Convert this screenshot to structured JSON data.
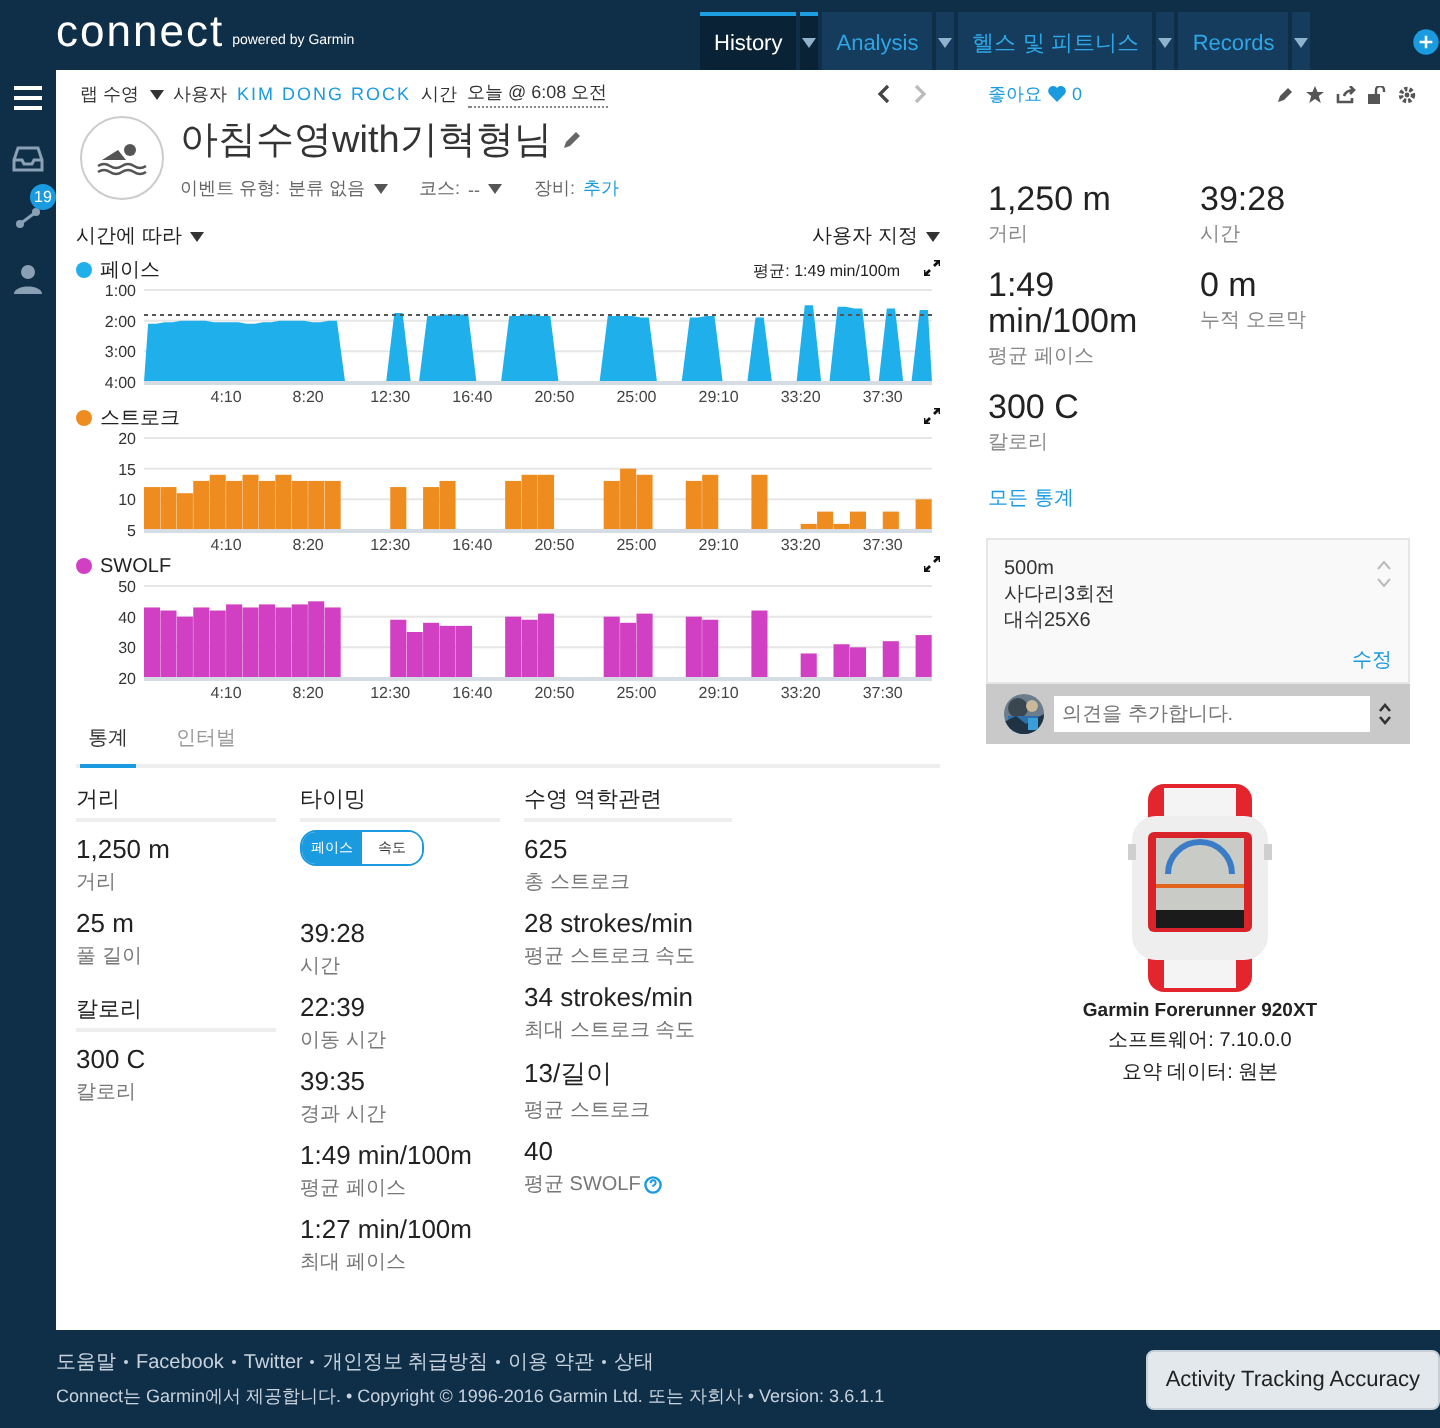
{
  "header": {
    "logo": "connect",
    "tagline": "powered by Garmin",
    "tabs": [
      {
        "label": "History",
        "selected": true
      },
      {
        "label": "Analysis",
        "selected": false
      },
      {
        "label": "헬스 및 피트니스",
        "selected": false
      },
      {
        "label": "Records",
        "selected": false
      }
    ]
  },
  "sidebar": {
    "items": [
      {
        "kind": "menu"
      },
      {
        "kind": "inbox"
      },
      {
        "kind": "connections",
        "badge": "19"
      },
      {
        "kind": "profile"
      }
    ]
  },
  "activity": {
    "type": "랩 수영",
    "by_label": "사용자",
    "user": "KIM DONG ROCK",
    "time_label": "시간",
    "time": "오늘 @ 6:08 오전",
    "likes_label": "좋아요",
    "likes": "0",
    "name": "아침수영with기혁형님",
    "event_type_label": "이벤트 유형:",
    "event_type": "분류 없음",
    "course_label": "코스:",
    "course": "--",
    "gear_label": "장비:",
    "gear": "추가"
  },
  "chart_controls": {
    "x_axis": "시간에 따라",
    "view": "사용자 지정"
  },
  "charts": [
    {
      "chart_data": {
        "type": "area",
        "title": "페이스",
        "x": [
          0,
          12.5,
          37.5,
          62.5,
          87.5,
          112.5,
          137.5,
          162.5,
          187.5,
          212.5,
          237.5,
          262.5,
          287.5,
          312.5,
          337.5,
          362.5,
          387.5,
          412.5,
          437.5,
          462.5,
          487.5,
          512.5,
          537.5,
          562.5,
          587.5,
          612.5,
          637.5,
          662.5,
          687.5,
          712.5,
          737.5,
          762.5,
          787.5,
          812.5,
          837.5,
          862.5,
          887.5,
          912.5,
          937.5,
          962.5,
          987.5,
          1012.5,
          1037.5,
          1062.5,
          1087.5,
          1112.5,
          1137.5,
          1162.5,
          1187.5,
          1212.5,
          1237.5,
          1262.5,
          1287.5,
          1312.5,
          1337.5,
          1362.5,
          1387.5,
          1412.5,
          1437.5,
          1462.5,
          1487.5,
          1512.5,
          1537.5,
          1562.5,
          1587.5,
          1612.5,
          1637.5,
          1662.5,
          1687.5,
          1712.5,
          1737.5,
          1762.5,
          1787.5,
          1812.5,
          1837.5,
          1862.5,
          1887.5,
          1912.5,
          1937.5,
          1962.5,
          1987.5,
          2012.5,
          2037.5,
          2062.5,
          2087.5,
          2112.5,
          2137.5,
          2162.5,
          2187.5,
          2212.5,
          2237.5,
          2262.5,
          2287.5,
          2312.5,
          2337.5,
          2362.5,
          2387.5,
          2400
        ],
        "xlim": [
          0,
          2400
        ],
        "ylim": [
          4,
          1
        ],
        "series": [
          {
            "color": "#1fb0ec",
            "values": [
              4,
              2.1,
              2.1,
              2.05,
              2.05,
              2.0,
              2.0,
              2.0,
              2.0,
              2.05,
              2.05,
              2.05,
              2.05,
              2.1,
              2.1,
              2.05,
              2.05,
              2.0,
              2.0,
              2.0,
              2.0,
              2.05,
              2.05,
              2.0,
              2.0,
              4,
              4,
              4,
              4,
              4,
              4,
              1.75,
              1.75,
              4,
              4,
              1.85,
              1.85,
              1.8,
              1.8,
              1.8,
              1.8,
              4,
              4,
              4,
              4,
              1.85,
              1.85,
              1.8,
              1.8,
              1.85,
              1.85,
              4,
              4,
              4,
              4,
              4,
              4,
              1.85,
              1.85,
              1.85,
              1.85,
              1.9,
              1.9,
              4,
              4,
              4,
              4,
              1.9,
              1.9,
              1.85,
              1.85,
              4,
              4,
              4,
              4,
              1.9,
              1.9,
              4,
              4,
              4,
              4,
              1.5,
              1.5,
              4,
              4,
              1.55,
              1.55,
              1.6,
              1.6,
              4,
              4,
              1.6,
              1.6,
              4,
              4,
              1.65,
              1.65,
              4
            ]
          }
        ],
        "xticks": [
          {
            "value": 250,
            "label": "4:10"
          },
          {
            "value": 500,
            "label": "8:20"
          },
          {
            "value": 750,
            "label": "12:30"
          },
          {
            "value": 1000,
            "label": "16:40"
          },
          {
            "value": 1250,
            "label": "20:50"
          },
          {
            "value": 1500,
            "label": "25:00"
          },
          {
            "value": 1750,
            "label": "29:10"
          },
          {
            "value": 2000,
            "label": "33:20"
          },
          {
            "value": 2250,
            "label": "37:30"
          }
        ],
        "yticks": [
          {
            "value": 1,
            "label": "1:00"
          },
          {
            "value": 2,
            "label": "2:00"
          },
          {
            "value": 3,
            "label": "3:00"
          },
          {
            "value": 4,
            "label": "4:00"
          }
        ],
        "ref_lines": [
          {
            "axis": "y",
            "value": 1.8167
          }
        ]
      },
      "average_label": "평균: 1:49 min/100m"
    },
    {
      "chart_data": {
        "type": "bar",
        "title": "스트로크",
        "x": [
          25,
          75,
          125,
          175,
          225,
          275,
          325,
          375,
          425,
          475,
          525,
          575,
          775,
          875,
          925,
          1125,
          1175,
          1225,
          1425,
          1475,
          1525,
          1675,
          1725,
          1875,
          2025,
          2075,
          2125,
          2175,
          2275,
          2375
        ],
        "xlim": [
          0,
          2400
        ],
        "ylim": [
          5,
          20
        ],
        "series": [
          {
            "color": "#ef8c20",
            "values": [
              12,
              12,
              11,
              13,
              14,
              13,
              14,
              13,
              14,
              13,
              13,
              13,
              12,
              12,
              13,
              13,
              14,
              14,
              13,
              15,
              14,
              13,
              14,
              14,
              6,
              8,
              6,
              8,
              8,
              10
            ]
          }
        ],
        "xticks": [
          {
            "value": 250,
            "label": "4:10"
          },
          {
            "value": 500,
            "label": "8:20"
          },
          {
            "value": 750,
            "label": "12:30"
          },
          {
            "value": 1000,
            "label": "16:40"
          },
          {
            "value": 1250,
            "label": "20:50"
          },
          {
            "value": 1500,
            "label": "25:00"
          },
          {
            "value": 1750,
            "label": "29:10"
          },
          {
            "value": 2000,
            "label": "33:20"
          },
          {
            "value": 2250,
            "label": "37:30"
          }
        ],
        "yticks": [
          5,
          10,
          15,
          20
        ]
      }
    },
    {
      "chart_data": {
        "type": "bar",
        "title": "SWOLF",
        "x": [
          25,
          75,
          125,
          175,
          225,
          275,
          325,
          375,
          425,
          475,
          525,
          575,
          775,
          825,
          875,
          925,
          975,
          1125,
          1175,
          1225,
          1425,
          1475,
          1525,
          1675,
          1725,
          1875,
          2025,
          2125,
          2175,
          2275,
          2375
        ],
        "xlim": [
          0,
          2400
        ],
        "ylim": [
          20,
          50
        ],
        "series": [
          {
            "color": "#d13fc2",
            "values": [
              43,
              42,
              40,
              43,
              42,
              44,
              43,
              44,
              43,
              44,
              45,
              43,
              39,
              35,
              38,
              37,
              37,
              40,
              39,
              41,
              40,
              38,
              41,
              40,
              39,
              42,
              28,
              31,
              30,
              32,
              34
            ]
          }
        ],
        "xticks": [
          {
            "value": 250,
            "label": "4:10"
          },
          {
            "value": 500,
            "label": "8:20"
          },
          {
            "value": 750,
            "label": "12:30"
          },
          {
            "value": 1000,
            "label": "16:40"
          },
          {
            "value": 1250,
            "label": "20:50"
          },
          {
            "value": 1500,
            "label": "25:00"
          },
          {
            "value": 1750,
            "label": "29:10"
          },
          {
            "value": 2000,
            "label": "33:20"
          },
          {
            "value": 2250,
            "label": "37:30"
          }
        ],
        "yticks": [
          20,
          30,
          40,
          50
        ]
      }
    }
  ],
  "stats_tabs": [
    {
      "label": "통계",
      "selected": true
    },
    {
      "label": "인터벌",
      "selected": false
    }
  ],
  "stat_columns": [
    {
      "groups": [
        {
          "title": "거리",
          "items": [
            {
              "value": "1,250 m",
              "label": "거리",
              "help": false
            },
            {
              "value": "25 m",
              "label": "풀 길이",
              "help": false
            }
          ]
        },
        {
          "title": "칼로리",
          "items": [
            {
              "value": "300 C",
              "label": "칼로리",
              "help": false
            }
          ]
        }
      ]
    },
    {
      "groups": [
        {
          "title": "타이밍",
          "toggle": [
            {
              "label": "페이스",
              "selected": true
            },
            {
              "label": "속도",
              "selected": false
            }
          ],
          "items": [
            {
              "value": "39:28",
              "label": "시간",
              "help": false
            },
            {
              "value": "22:39",
              "label": "이동 시간",
              "help": false
            },
            {
              "value": "39:35",
              "label": "경과 시간",
              "help": false
            },
            {
              "value": "1:49 min/100m",
              "label": "평균 페이스",
              "help": false
            },
            {
              "value": "1:27 min/100m",
              "label": "최대 페이스",
              "help": false
            }
          ]
        }
      ]
    },
    {
      "groups": [
        {
          "title": "수영 역학관련",
          "items": [
            {
              "value": "625",
              "label": "총 스트로크",
              "help": false
            },
            {
              "value": "28 strokes/min",
              "label": "평균 스트로크 속도",
              "help": false
            },
            {
              "value": "34 strokes/min",
              "label": "최대 스트로크 속도",
              "help": false
            },
            {
              "value": "13/길이",
              "label": "평균 스트로크",
              "help": false
            },
            {
              "value": "40",
              "label": "평균 SWOLF",
              "help": true
            }
          ]
        }
      ]
    }
  ],
  "summary": [
    {
      "value": "1,250 m",
      "label": "거리"
    },
    {
      "value": "39:28",
      "label": "시간"
    },
    {
      "value": "1:49 min/100m",
      "label": "평균 페이스"
    },
    {
      "value": "0 m",
      "label": "누적 오르막"
    },
    {
      "value": "300 C",
      "label": "칼로리"
    }
  ],
  "all_stats_link": "모든 통계",
  "notes": {
    "lines": [
      "500m",
      "사다리3회전",
      "대쉬25X6"
    ],
    "edit": "수정"
  },
  "comment": {
    "placeholder": "의견을 추가합니다."
  },
  "device": {
    "kind": "picture",
    "name": "Garmin Forerunner 920XT",
    "software": "소프트웨어: 7.10.0.0",
    "summary_data": "요약 데이터: 원본"
  },
  "footer": {
    "links": [
      "도움말",
      "Facebook",
      "Twitter",
      "개인정보 취급방침",
      "이용 약관",
      "상태"
    ],
    "copyright": "Connect는 Garmin에서 제공합니다. • Copyright © 1996-2016 Garmin Ltd. 또는 자회사 • Version: 3.6.1.1",
    "accuracy_button": "Activity Tracking Accuracy"
  }
}
